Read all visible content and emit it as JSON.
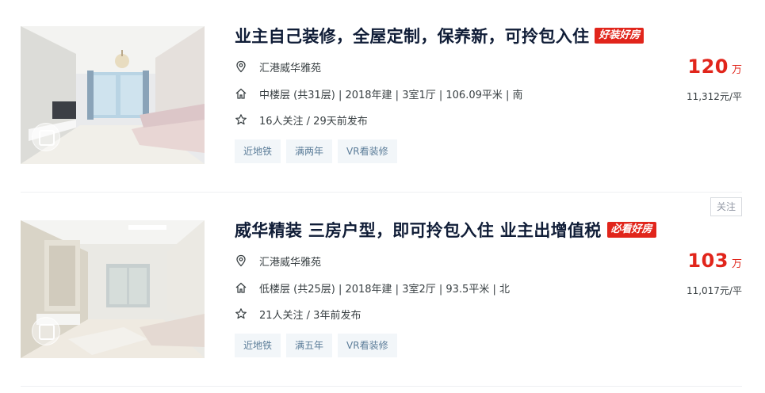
{
  "listings": [
    {
      "title": "业主自己装修，全屋定制，保养新，可拎包入住",
      "badge": "好装好房",
      "community": "汇港威华雅苑",
      "details": "中楼层 (共31层) | 2018年建 | 3室1厅 | 106.09平米 | 南",
      "followers": "16人关注 / 29天前发布",
      "tags": [
        "近地铁",
        "满两年",
        "VR看装修"
      ],
      "price": "120",
      "price_unit": "万",
      "unit_price": "11,312元/平",
      "follow_label": ""
    },
    {
      "title": "威华精装 三房户型，即可拎包入住 业主出增值税",
      "badge": "必看好房",
      "community": "汇港威华雅苑",
      "details": "低楼层 (共25层) | 2018年建 | 3室2厅 | 93.5平米 | 北",
      "followers": "21人关注 / 3年前发布",
      "tags": [
        "近地铁",
        "满五年",
        "VR看装修"
      ],
      "price": "103",
      "price_unit": "万",
      "unit_price": "11,017元/平",
      "follow_label": "关注"
    }
  ],
  "icons": {
    "location": "location-pin-icon",
    "house": "house-icon",
    "star": "star-icon"
  },
  "colors": {
    "accent_red": "#e1251b",
    "title": "#101d37",
    "tag_bg": "#f2f6f9",
    "tag_text": "#5c7d99"
  }
}
